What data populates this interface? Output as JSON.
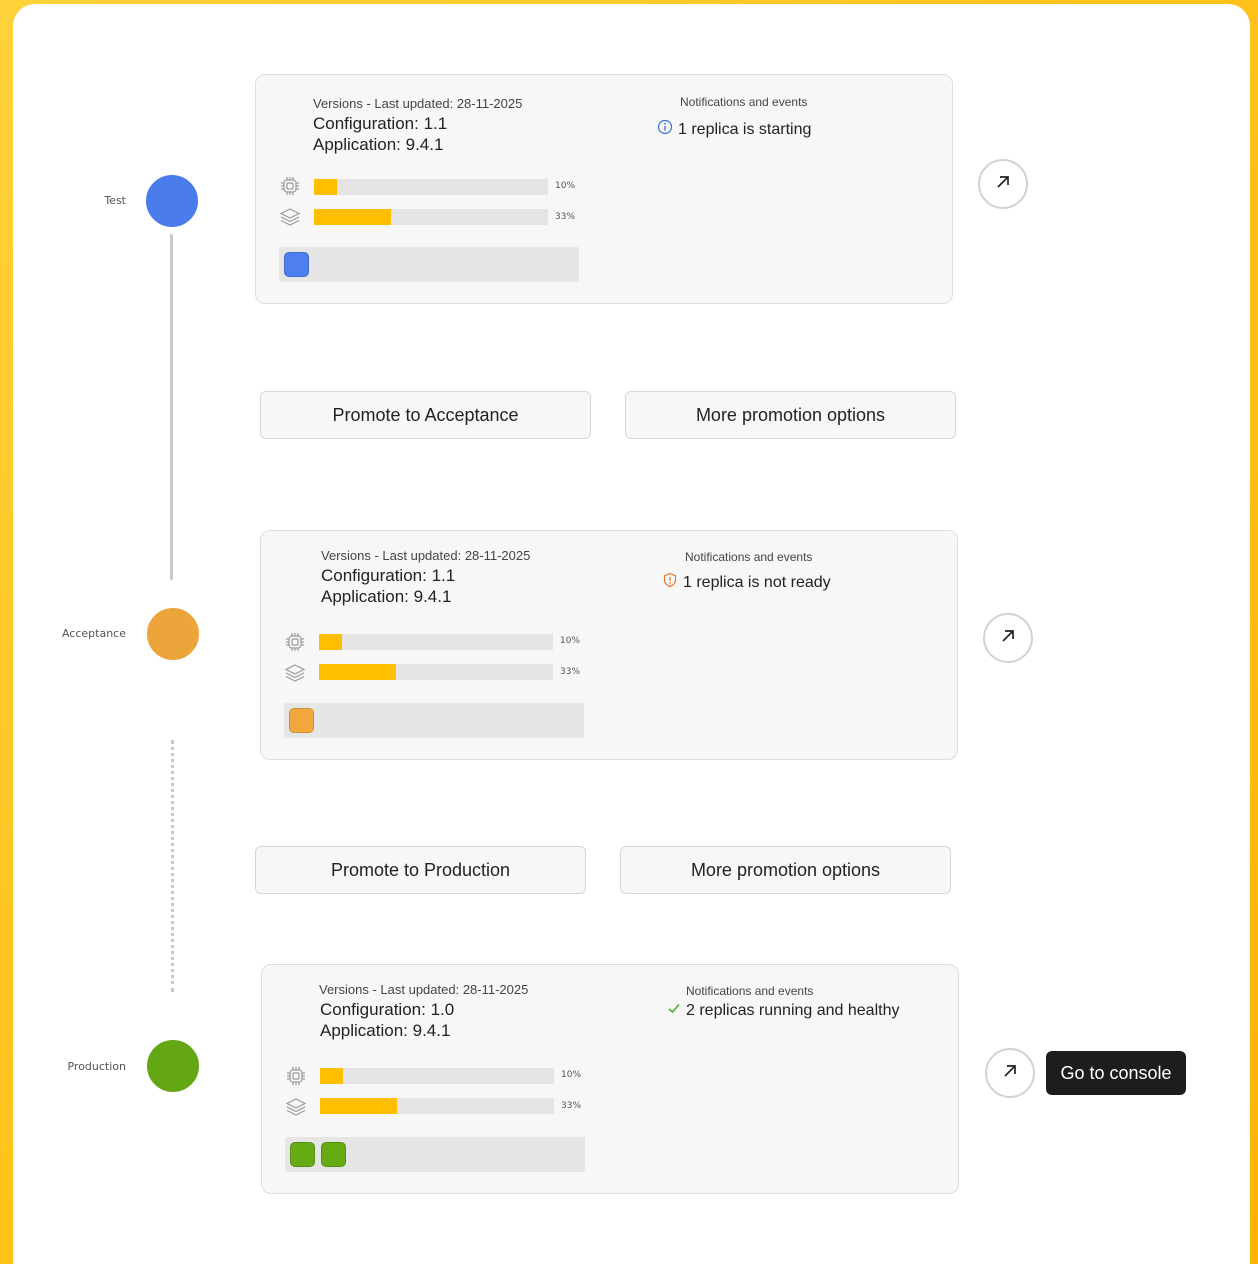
{
  "environments": [
    {
      "name": "Test",
      "color": "#4d7ff0",
      "versions_header": "Versions - Last updated: 28-11-2025",
      "configuration": "Configuration: 1.1",
      "application": "Application: 9.4.1",
      "notifications_header": "Notifications and events",
      "notification": "1 replica is starting",
      "notification_icon": "info-icon",
      "cpu_percent": 10,
      "cpu_label": "10%",
      "memory_percent": 33,
      "memory_label": "33%",
      "replicas": 1
    },
    {
      "name": "Acceptance",
      "color": "#f0a83c",
      "versions_header": "Versions - Last updated: 28-11-2025",
      "configuration": "Configuration: 1.1",
      "application": "Application: 9.4.1",
      "notifications_header": "Notifications and events",
      "notification": "1 replica is not ready",
      "notification_icon": "warning-shield-icon",
      "cpu_percent": 10,
      "cpu_label": "10%",
      "memory_percent": 33,
      "memory_label": "33%",
      "replicas": 1
    },
    {
      "name": "Production",
      "color": "#66aa14",
      "versions_header": "Versions - Last updated: 28-11-2025",
      "configuration": "Configuration: 1.0",
      "application": "Application: 9.4.1",
      "notifications_header": "Notifications and events",
      "notification": "2 replicas running and healthy",
      "notification_icon": "checkmark-icon",
      "cpu_percent": 10,
      "cpu_label": "10%",
      "memory_percent": 33,
      "memory_label": "33%",
      "replicas": 2
    }
  ],
  "promotions": [
    {
      "primary_label": "Promote to Acceptance",
      "secondary_label": "More promotion options"
    },
    {
      "primary_label": "Promote to Production",
      "secondary_label": "More promotion options"
    }
  ],
  "tooltip": "Go to console",
  "colors": {
    "bar_fill": "#ffbf00",
    "info": "#3a6fd8",
    "warning": "#e8772e",
    "success": "#4caf2f"
  }
}
